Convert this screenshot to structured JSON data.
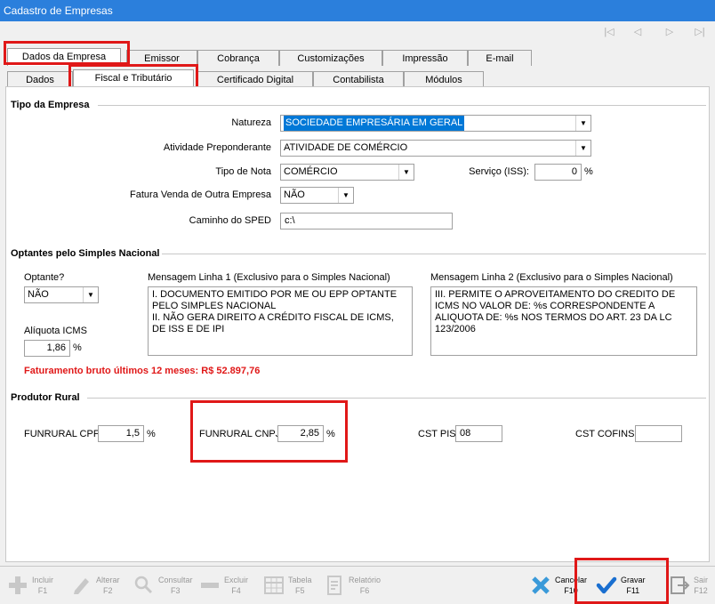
{
  "window": {
    "title": "Cadastro de Empresas"
  },
  "nav": {
    "first": "|◁",
    "prev": "◁",
    "next": "▷",
    "last": "▷|"
  },
  "main_tabs": [
    "Dados da Empresa",
    "Emissor",
    "Cobrança",
    "Customizações",
    "Impressão",
    "E-mail"
  ],
  "sub_tabs": [
    "Dados",
    "Fiscal e Tributário",
    "Certificado Digital",
    "Contabilista",
    "Módulos"
  ],
  "tipo_empresa": {
    "section": "Tipo da Empresa",
    "natureza_label": "Natureza",
    "natureza_value": "SOCIEDADE EMPRESÁRIA EM GERAL",
    "atividade_label": "Atividade Preponderante",
    "atividade_value": "ATIVIDADE DE COMÉRCIO",
    "tipo_nota_label": "Tipo de Nota",
    "tipo_nota_value": "COMÉRCIO",
    "servico_label": "Serviço (ISS):",
    "servico_value": "0",
    "servico_unit": "%",
    "fatura_label": "Fatura Venda de Outra Empresa",
    "fatura_value": "NÃO",
    "sped_label": "Caminho do SPED",
    "sped_value": "c:\\"
  },
  "simples": {
    "section": "Optantes pelo Simples Nacional",
    "optante_label": "Optante?",
    "optante_value": "NÃO",
    "aliquota_label": "Alíquota ICMS",
    "aliquota_value": "1,86",
    "aliquota_unit": "%",
    "msg1_label": "Mensagem Linha 1 (Exclusivo para  o Simples Nacional)",
    "msg1_value": "I. DOCUMENTO EMITIDO POR ME OU EPP OPTANTE PELO SIMPLES NACIONAL\nII. NÃO GERA DIREITO A CRÉDITO FISCAL DE ICMS, DE ISS E DE IPI",
    "msg2_label": "Mensagem Linha 2 (Exclusivo para o Simples Nacional)",
    "msg2_value": "III. PERMITE O APROVEITAMENTO DO CREDITO DE ICMS NO VALOR DE: %s CORRESPONDENTE A ALIQUOTA DE: %s NOS TERMOS DO ART. 23 DA LC 123/2006",
    "faturamento": "Faturamento bruto últimos 12 meses: R$ 52.897,76"
  },
  "produtor": {
    "section": "Produtor Rural",
    "funrural_cpf_label": "FUNRURAL CPF",
    "funrural_cpf_value": "1,5",
    "funrural_cpf_unit": "%",
    "funrural_cnpj_label": "FUNRURAL CNPJ",
    "funrural_cnpj_value": "2,85",
    "funrural_cnpj_unit": "%",
    "cst_pis_label": "CST PIS",
    "cst_pis_value": "08",
    "cst_cofins_label": "CST COFINS",
    "cst_cofins_value": ""
  },
  "toolbar": {
    "incluir": "Incluir",
    "incluir_key": "F1",
    "alterar": "Alterar",
    "alterar_key": "F2",
    "consultar": "Consultar",
    "consultar_key": "F3",
    "excluir": "Excluir",
    "excluir_key": "F4",
    "tabela": "Tabela",
    "tabela_key": "F5",
    "relatorio": "Relatório",
    "relatorio_key": "F6",
    "cancelar": "Cancelar",
    "cancelar_key": "F10",
    "gravar": "Gravar",
    "gravar_key": "F11",
    "sair": "Sair",
    "sair_key": "F12"
  },
  "colors": {
    "titlebar": "#2b7fdc",
    "highlight": "#e01818",
    "selection": "#0078d7",
    "check": "#1a6fd0",
    "cancel": "#3a9ad9"
  }
}
